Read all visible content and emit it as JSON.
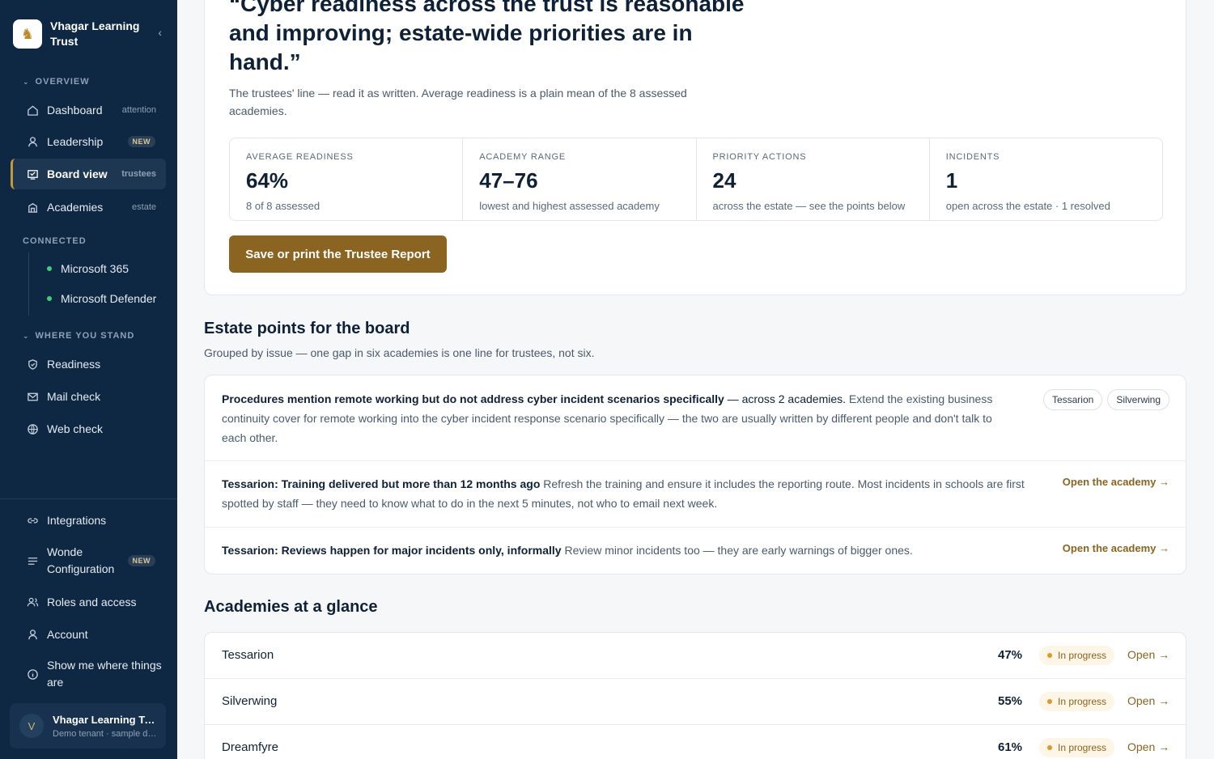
{
  "brand": {
    "name": "Vhagar Learning Trust"
  },
  "sidebar": {
    "overview_label": "OVERVIEW",
    "connected_label": "CONNECTED",
    "where_label": "WHERE YOU STAND",
    "items": [
      {
        "label": "Dashboard",
        "hint": "attention",
        "icon": "home-icon"
      },
      {
        "label": "Leadership",
        "badge": "NEW",
        "icon": "person-icon"
      },
      {
        "label": "Board view",
        "hint": "trustees",
        "icon": "board-icon"
      },
      {
        "label": "Academies",
        "hint": "estate",
        "icon": "building-icon"
      }
    ],
    "connected": [
      "Microsoft 365",
      "Microsoft Defender"
    ],
    "where": [
      {
        "label": "Readiness",
        "icon": "shield-icon"
      },
      {
        "label": "Mail check",
        "icon": "mail-icon"
      },
      {
        "label": "Web check",
        "icon": "globe-icon"
      }
    ],
    "bottom": [
      {
        "label": "Integrations",
        "icon": "link-icon"
      },
      {
        "label": "Wonde Configuration",
        "badge": "NEW",
        "icon": "list-icon"
      },
      {
        "label": "Roles and access",
        "icon": "people-icon"
      },
      {
        "label": "Account",
        "icon": "user-icon"
      },
      {
        "label": "Show me where things are",
        "icon": "info-icon"
      }
    ],
    "user": {
      "initial": "V",
      "name": "Vhagar Learning Trust",
      "sub": "Demo tenant · sample data"
    }
  },
  "hero": {
    "quote": "“Cyber readiness across the trust is reasonable and improving; estate-wide priorities are in hand.”",
    "sub": "The trustees' line — read it as written. Average readiness is a plain mean of the 8 assessed academies.",
    "stats": [
      {
        "label": "AVERAGE READINESS",
        "value": "64%",
        "sub": "8 of 8 assessed"
      },
      {
        "label": "ACADEMY RANGE",
        "value": "47–76",
        "sub": "lowest and highest assessed academy"
      },
      {
        "label": "PRIORITY ACTIONS",
        "value": "24",
        "sub": "across the estate — see the points below"
      },
      {
        "label": "INCIDENTS",
        "value": "1",
        "sub": "open across the estate · 1 resolved"
      }
    ],
    "report_button": "Save or print the Trustee Report"
  },
  "points": {
    "title": "Estate points for the board",
    "sub": "Grouped by issue — one gap in six academies is one line for trustees, not six.",
    "items": [
      {
        "bold": "Procedures mention remote working but do not address cyber incident scenarios specifically",
        "mid": " — across 2 academies.",
        "rest": " Extend the existing business continuity cover for remote working into the cyber incident response scenario specifically — the two are usually written by different people and don't talk to each other.",
        "chips": [
          "Tessarion",
          "Silverwing"
        ]
      },
      {
        "bold": "Tessarion: Training delivered but more than 12 months ago",
        "rest": " Refresh the training and ensure it includes the reporting route. Most incidents in schools are first spotted by staff — they need to know what to do in the next 5 minutes, not who to email next week.",
        "link": "Open the academy →"
      },
      {
        "bold": "Tessarion: Reviews happen for major incidents only, informally",
        "rest": " Review minor incidents too — they are early warnings of bigger ones.",
        "link": "Open the academy →"
      }
    ]
  },
  "glance": {
    "title": "Academies at a glance",
    "rows": [
      {
        "name": "Tessarion",
        "pct": "47%",
        "status": "In progress",
        "open": "Open →"
      },
      {
        "name": "Silverwing",
        "pct": "55%",
        "status": "In progress",
        "open": "Open →"
      },
      {
        "name": "Dreamfyre",
        "pct": "61%",
        "status": "In progress",
        "open": "Open →"
      }
    ]
  }
}
